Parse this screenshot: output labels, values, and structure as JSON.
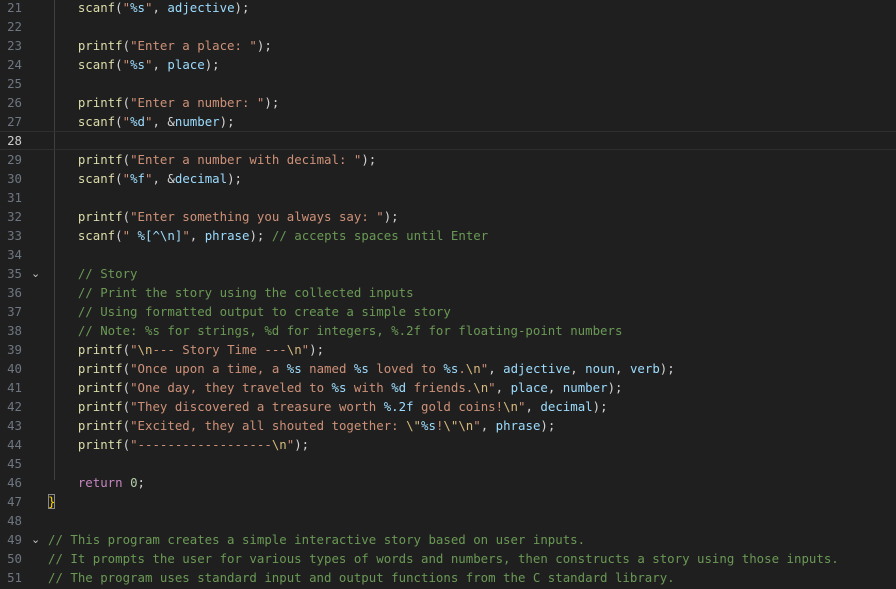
{
  "editor": {
    "current_line": "28",
    "lines": [
      {
        "n": "21",
        "fold": "",
        "tokens": [
          [
            "    ",
            "t-op"
          ],
          [
            "scanf",
            "t-fn"
          ],
          [
            "(",
            "t-op"
          ],
          [
            "\"",
            "t-str"
          ],
          [
            "%s",
            "t-fmt"
          ],
          [
            "\"",
            "t-str"
          ],
          [
            ", ",
            "t-op"
          ],
          [
            "adjective",
            "t-var"
          ],
          [
            ");",
            "t-op"
          ]
        ]
      },
      {
        "n": "22",
        "fold": "",
        "tokens": []
      },
      {
        "n": "23",
        "fold": "",
        "tokens": [
          [
            "    ",
            "t-op"
          ],
          [
            "printf",
            "t-fn"
          ],
          [
            "(",
            "t-op"
          ],
          [
            "\"Enter a place: \"",
            "t-str"
          ],
          [
            ");",
            "t-op"
          ]
        ]
      },
      {
        "n": "24",
        "fold": "",
        "tokens": [
          [
            "    ",
            "t-op"
          ],
          [
            "scanf",
            "t-fn"
          ],
          [
            "(",
            "t-op"
          ],
          [
            "\"",
            "t-str"
          ],
          [
            "%s",
            "t-fmt"
          ],
          [
            "\"",
            "t-str"
          ],
          [
            ", ",
            "t-op"
          ],
          [
            "place",
            "t-var"
          ],
          [
            ");",
            "t-op"
          ]
        ]
      },
      {
        "n": "25",
        "fold": "",
        "tokens": []
      },
      {
        "n": "26",
        "fold": "",
        "tokens": [
          [
            "    ",
            "t-op"
          ],
          [
            "printf",
            "t-fn"
          ],
          [
            "(",
            "t-op"
          ],
          [
            "\"Enter a number: \"",
            "t-str"
          ],
          [
            ");",
            "t-op"
          ]
        ]
      },
      {
        "n": "27",
        "fold": "",
        "tokens": [
          [
            "    ",
            "t-op"
          ],
          [
            "scanf",
            "t-fn"
          ],
          [
            "(",
            "t-op"
          ],
          [
            "\"",
            "t-str"
          ],
          [
            "%d",
            "t-fmt"
          ],
          [
            "\"",
            "t-str"
          ],
          [
            ", &",
            "t-op"
          ],
          [
            "number",
            "t-var"
          ],
          [
            ");",
            "t-op"
          ]
        ]
      },
      {
        "n": "28",
        "fold": "",
        "tokens": []
      },
      {
        "n": "29",
        "fold": "",
        "tokens": [
          [
            "    ",
            "t-op"
          ],
          [
            "printf",
            "t-fn"
          ],
          [
            "(",
            "t-op"
          ],
          [
            "\"Enter a number with decimal: \"",
            "t-str"
          ],
          [
            ");",
            "t-op"
          ]
        ]
      },
      {
        "n": "30",
        "fold": "",
        "tokens": [
          [
            "    ",
            "t-op"
          ],
          [
            "scanf",
            "t-fn"
          ],
          [
            "(",
            "t-op"
          ],
          [
            "\"",
            "t-str"
          ],
          [
            "%f",
            "t-fmt"
          ],
          [
            "\"",
            "t-str"
          ],
          [
            ", &",
            "t-op"
          ],
          [
            "decimal",
            "t-var"
          ],
          [
            ");",
            "t-op"
          ]
        ]
      },
      {
        "n": "31",
        "fold": "",
        "tokens": []
      },
      {
        "n": "32",
        "fold": "",
        "tokens": [
          [
            "    ",
            "t-op"
          ],
          [
            "printf",
            "t-fn"
          ],
          [
            "(",
            "t-op"
          ],
          [
            "\"Enter something you always say: \"",
            "t-str"
          ],
          [
            ");",
            "t-op"
          ]
        ]
      },
      {
        "n": "33",
        "fold": "",
        "tokens": [
          [
            "    ",
            "t-op"
          ],
          [
            "scanf",
            "t-fn"
          ],
          [
            "(",
            "t-op"
          ],
          [
            "\" ",
            "t-str"
          ],
          [
            "%[^\\n]",
            "t-fmt"
          ],
          [
            "\"",
            "t-str"
          ],
          [
            ", ",
            "t-op"
          ],
          [
            "phrase",
            "t-var"
          ],
          [
            "); ",
            "t-op"
          ],
          [
            "// accepts spaces until Enter",
            "t-cm"
          ]
        ]
      },
      {
        "n": "34",
        "fold": "",
        "tokens": []
      },
      {
        "n": "35",
        "fold": "⌄",
        "tokens": [
          [
            "    ",
            "t-op"
          ],
          [
            "// Story",
            "t-cm"
          ]
        ]
      },
      {
        "n": "36",
        "fold": "",
        "tokens": [
          [
            "    ",
            "t-op"
          ],
          [
            "// Print the story using the collected inputs",
            "t-cm"
          ]
        ]
      },
      {
        "n": "37",
        "fold": "",
        "tokens": [
          [
            "    ",
            "t-op"
          ],
          [
            "// Using formatted output to create a simple story",
            "t-cm"
          ]
        ]
      },
      {
        "n": "38",
        "fold": "",
        "tokens": [
          [
            "    ",
            "t-op"
          ],
          [
            "// Note: %s for strings, %d for integers, %.2f for floating-point numbers",
            "t-cm"
          ]
        ]
      },
      {
        "n": "39",
        "fold": "",
        "tokens": [
          [
            "    ",
            "t-op"
          ],
          [
            "printf",
            "t-fn"
          ],
          [
            "(",
            "t-op"
          ],
          [
            "\"",
            "t-str"
          ],
          [
            "\\n",
            "t-esc"
          ],
          [
            "--- Story Time ---",
            "t-str"
          ],
          [
            "\\n",
            "t-esc"
          ],
          [
            "\"",
            "t-str"
          ],
          [
            ");",
            "t-op"
          ]
        ]
      },
      {
        "n": "40",
        "fold": "",
        "tokens": [
          [
            "    ",
            "t-op"
          ],
          [
            "printf",
            "t-fn"
          ],
          [
            "(",
            "t-op"
          ],
          [
            "\"Once upon a time, a ",
            "t-str"
          ],
          [
            "%s",
            "t-fmt"
          ],
          [
            " named ",
            "t-str"
          ],
          [
            "%s",
            "t-fmt"
          ],
          [
            " loved to ",
            "t-str"
          ],
          [
            "%s",
            "t-fmt"
          ],
          [
            ".",
            "t-str"
          ],
          [
            "\\n",
            "t-esc"
          ],
          [
            "\"",
            "t-str"
          ],
          [
            ", ",
            "t-op"
          ],
          [
            "adjective",
            "t-var"
          ],
          [
            ", ",
            "t-op"
          ],
          [
            "noun",
            "t-var"
          ],
          [
            ", ",
            "t-op"
          ],
          [
            "verb",
            "t-var"
          ],
          [
            ");",
            "t-op"
          ]
        ]
      },
      {
        "n": "41",
        "fold": "",
        "tokens": [
          [
            "    ",
            "t-op"
          ],
          [
            "printf",
            "t-fn"
          ],
          [
            "(",
            "t-op"
          ],
          [
            "\"One day, they traveled to ",
            "t-str"
          ],
          [
            "%s",
            "t-fmt"
          ],
          [
            " with ",
            "t-str"
          ],
          [
            "%d",
            "t-fmt"
          ],
          [
            " friends.",
            "t-str"
          ],
          [
            "\\n",
            "t-esc"
          ],
          [
            "\"",
            "t-str"
          ],
          [
            ", ",
            "t-op"
          ],
          [
            "place",
            "t-var"
          ],
          [
            ", ",
            "t-op"
          ],
          [
            "number",
            "t-var"
          ],
          [
            ");",
            "t-op"
          ]
        ]
      },
      {
        "n": "42",
        "fold": "",
        "tokens": [
          [
            "    ",
            "t-op"
          ],
          [
            "printf",
            "t-fn"
          ],
          [
            "(",
            "t-op"
          ],
          [
            "\"They discovered a treasure worth ",
            "t-str"
          ],
          [
            "%.2f",
            "t-fmt"
          ],
          [
            " gold coins!",
            "t-str"
          ],
          [
            "\\n",
            "t-esc"
          ],
          [
            "\"",
            "t-str"
          ],
          [
            ", ",
            "t-op"
          ],
          [
            "decimal",
            "t-var"
          ],
          [
            ");",
            "t-op"
          ]
        ]
      },
      {
        "n": "43",
        "fold": "",
        "tokens": [
          [
            "    ",
            "t-op"
          ],
          [
            "printf",
            "t-fn"
          ],
          [
            "(",
            "t-op"
          ],
          [
            "\"Excited, they all shouted together: ",
            "t-str"
          ],
          [
            "\\\"",
            "t-esc"
          ],
          [
            "%s",
            "t-fmt"
          ],
          [
            "!",
            "t-str"
          ],
          [
            "\\\"",
            "t-esc"
          ],
          [
            "\\n",
            "t-esc"
          ],
          [
            "\"",
            "t-str"
          ],
          [
            ", ",
            "t-op"
          ],
          [
            "phrase",
            "t-var"
          ],
          [
            ");",
            "t-op"
          ]
        ]
      },
      {
        "n": "44",
        "fold": "",
        "tokens": [
          [
            "    ",
            "t-op"
          ],
          [
            "printf",
            "t-fn"
          ],
          [
            "(",
            "t-op"
          ],
          [
            "\"------------------",
            "t-str"
          ],
          [
            "\\n",
            "t-esc"
          ],
          [
            "\"",
            "t-str"
          ],
          [
            ");",
            "t-op"
          ]
        ]
      },
      {
        "n": "45",
        "fold": "",
        "tokens": []
      },
      {
        "n": "46",
        "fold": "",
        "tokens": [
          [
            "    ",
            "t-op"
          ],
          [
            "return",
            "t-kw"
          ],
          [
            " ",
            "t-op"
          ],
          [
            "0",
            "t-num"
          ],
          [
            ";",
            "t-op"
          ]
        ]
      },
      {
        "n": "47",
        "fold": "",
        "tokens": [
          [
            "}",
            "t-brace brace-match"
          ]
        ]
      },
      {
        "n": "48",
        "fold": "",
        "tokens": []
      },
      {
        "n": "49",
        "fold": "⌄",
        "tokens": [
          [
            "// This program creates a simple interactive story based on user inputs.",
            "t-cm"
          ]
        ]
      },
      {
        "n": "50",
        "fold": "",
        "tokens": [
          [
            "// It prompts the user for various types of words and numbers, then constructs a story using those inputs.",
            "t-cm"
          ]
        ]
      },
      {
        "n": "51",
        "fold": "",
        "tokens": [
          [
            "// The program uses standard input and output functions from the C standard library.",
            "t-cm"
          ]
        ]
      }
    ]
  }
}
